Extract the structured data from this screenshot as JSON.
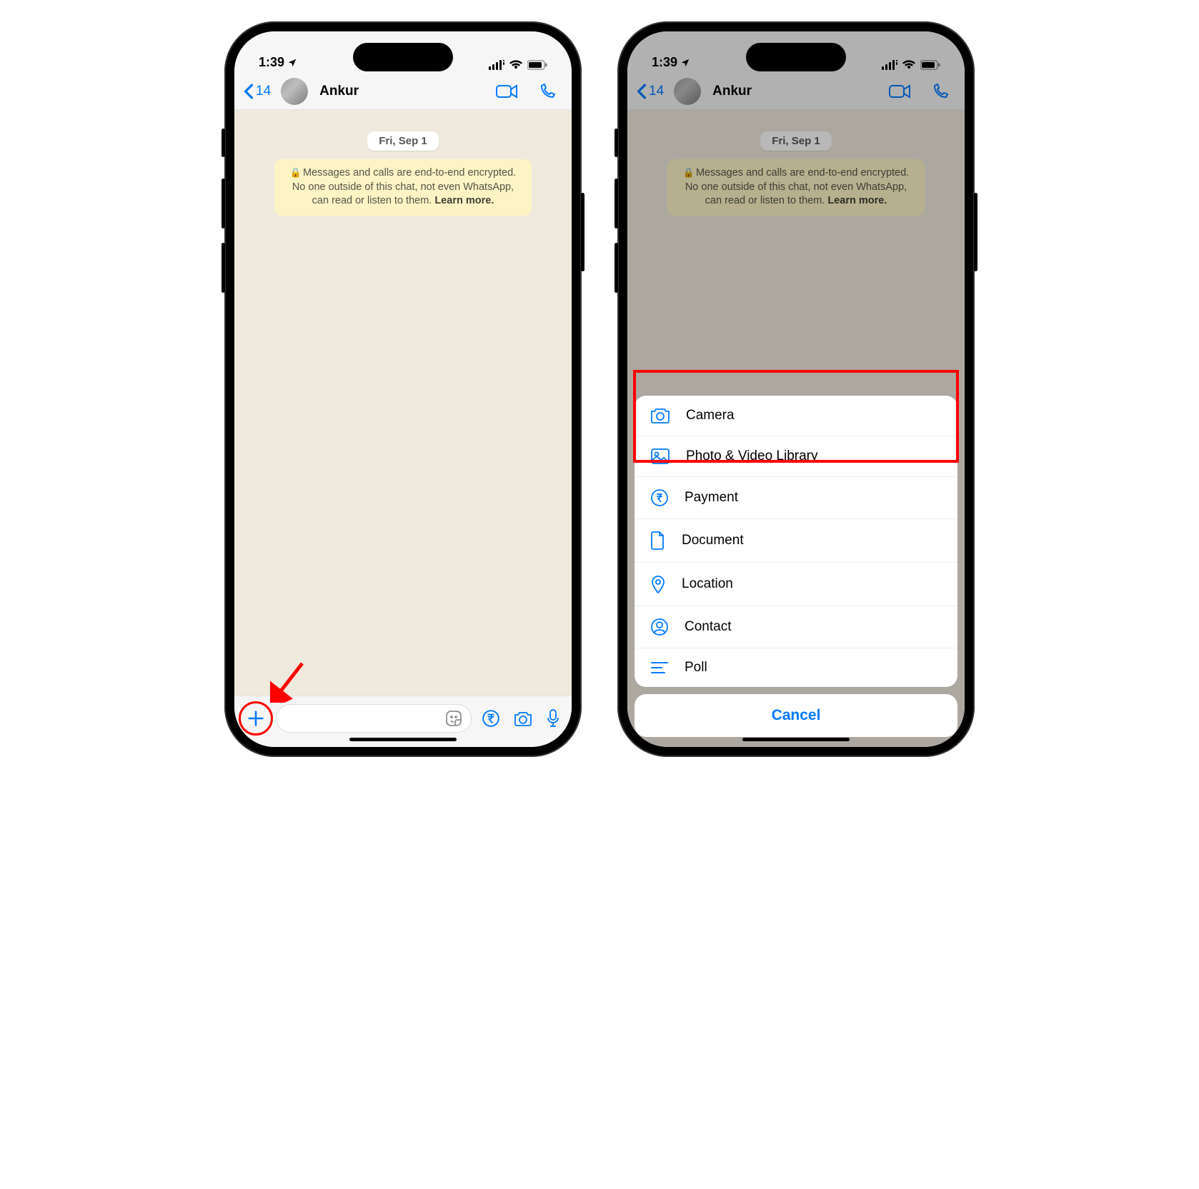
{
  "status": {
    "time": "1:39"
  },
  "nav": {
    "back_count": "14",
    "contact": "Ankur"
  },
  "chat": {
    "date": "Fri, Sep 1",
    "e2e_prefix": "Messages and calls are end-to-end encrypted. No one outside of this chat, not even WhatsApp, can read or listen to them. ",
    "e2e_learn": "Learn more."
  },
  "sheet": {
    "items": [
      {
        "label": "Camera"
      },
      {
        "label": "Photo & Video Library"
      },
      {
        "label": "Payment"
      },
      {
        "label": "Document"
      },
      {
        "label": "Location"
      },
      {
        "label": "Contact"
      },
      {
        "label": "Poll"
      }
    ],
    "cancel": "Cancel"
  }
}
